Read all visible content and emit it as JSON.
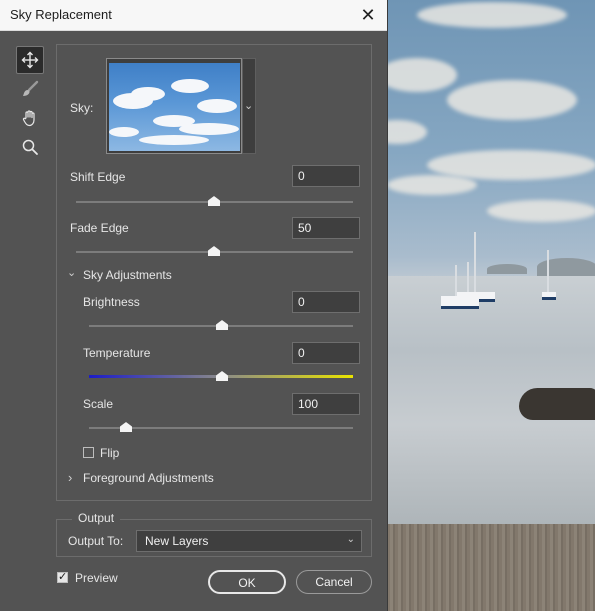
{
  "window": {
    "title": "Sky Replacement",
    "close_glyph": "✕"
  },
  "tools": [
    {
      "name": "move-tool",
      "icon": "move-icon"
    },
    {
      "name": "brush-tool",
      "icon": "brush-icon"
    },
    {
      "name": "hand-tool",
      "icon": "hand-icon"
    },
    {
      "name": "zoom-tool",
      "icon": "zoom-icon"
    }
  ],
  "sky": {
    "label": "Sky:",
    "dropdown_glyph": "⌄"
  },
  "shift_edge": {
    "label": "Shift Edge",
    "value": "0",
    "slider_fraction": 0.5
  },
  "fade_edge": {
    "label": "Fade Edge",
    "value": "50",
    "slider_fraction": 0.5
  },
  "sky_adjustments": {
    "label": "Sky Adjustments",
    "expanded_glyph": "⌄",
    "brightness": {
      "label": "Brightness",
      "value": "0",
      "slider_fraction": 0.5
    },
    "temperature": {
      "label": "Temperature",
      "value": "0",
      "slider_fraction": 0.5,
      "gradient_start": "#1c1cc8",
      "gradient_end": "#e9e400"
    },
    "scale": {
      "label": "Scale",
      "value": "100",
      "slider_fraction": 0.14
    },
    "flip": {
      "label": "Flip",
      "checked": false
    }
  },
  "foreground_adjustments": {
    "label": "Foreground Adjustments",
    "collapsed_glyph": "›"
  },
  "output": {
    "group_label": "Output",
    "output_to_label": "Output To:",
    "output_to_value": "New Layers",
    "select_glyph": "⌄"
  },
  "preview": {
    "label": "Preview",
    "checked": true
  },
  "buttons": {
    "ok": "OK",
    "cancel": "Cancel"
  },
  "colors": {
    "dialog_bg": "#535353",
    "title_bg": "#f7f7f7",
    "text": "#e6e6e6",
    "field_bg": "#3f3f3f"
  }
}
